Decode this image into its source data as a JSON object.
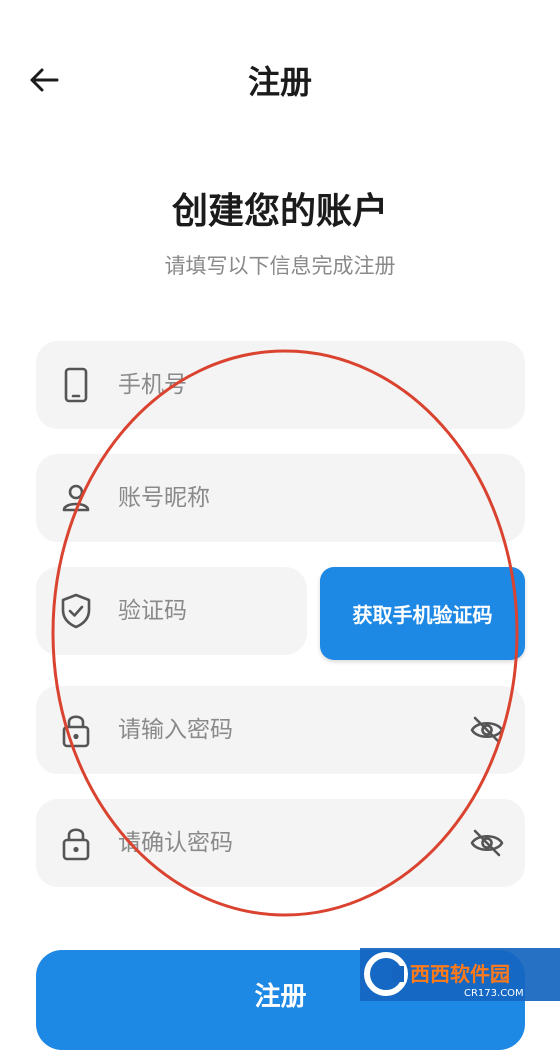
{
  "header": {
    "title": "注册",
    "back_icon": "arrow-left-icon"
  },
  "intro": {
    "title": "创建您的账户",
    "subtitle": "请填写以下信息完成注册"
  },
  "form": {
    "phone": {
      "placeholder": "手机号",
      "icon": "phone-icon"
    },
    "nickname": {
      "placeholder": "账号昵称",
      "icon": "person-icon"
    },
    "code": {
      "placeholder": "验证码",
      "icon": "shield-check-icon"
    },
    "get_code_label": "获取手机验证码",
    "password": {
      "placeholder": "请输入密码",
      "icon": "lock-icon",
      "toggle_icon": "eye-off-icon"
    },
    "confirm": {
      "placeholder": "请确认密码",
      "icon": "lock-icon",
      "toggle_icon": "eye-off-icon"
    },
    "submit_label": "注册"
  },
  "annotation": {
    "shape": "ellipse",
    "color": "#d9432f"
  },
  "watermark": {
    "text": "西西软件园",
    "subtext": "CR173.COM"
  },
  "colors": {
    "accent": "#1e88e5",
    "field_bg": "#f4f4f4",
    "placeholder": "#8a8a8a"
  }
}
